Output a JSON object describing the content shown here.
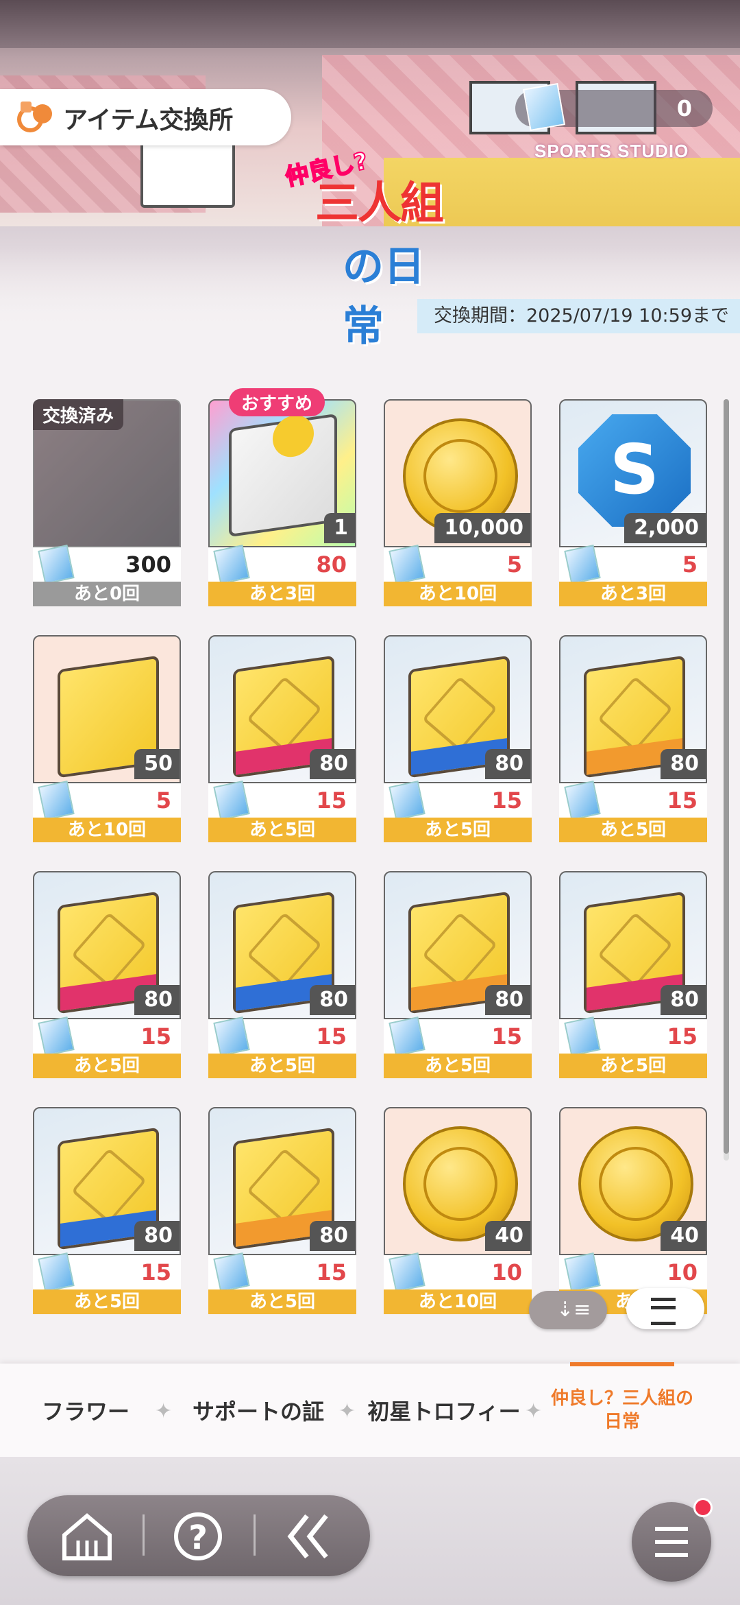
{
  "header": {
    "title": "アイテム交換所",
    "currency_value": "0",
    "event_logo_line1": "仲良し?",
    "event_logo_line2": "三人組",
    "event_logo_line3": "の日常",
    "studio_sign": "SPORTS STUDIO",
    "period": "交換期間：2025/07/19 10:59まで"
  },
  "items": [
    {
      "kind": "photo",
      "badge": "交換済み",
      "qty": "",
      "cost": "300",
      "remain": "あと0回",
      "state": "done"
    },
    {
      "kind": "gift",
      "badge": "おすすめ",
      "qty": "1",
      "cost": "80",
      "remain": "あと3回"
    },
    {
      "kind": "coin",
      "qty": "10,000",
      "cost": "5",
      "remain": "あと10回"
    },
    {
      "kind": "octa",
      "letter": "S",
      "qty": "2,000",
      "cost": "5",
      "remain": "あと3回"
    },
    {
      "kind": "book-plain",
      "qty": "50",
      "cost": "5",
      "remain": "あと10回"
    },
    {
      "kind": "book-pink",
      "qty": "80",
      "cost": "15",
      "remain": "あと5回"
    },
    {
      "kind": "book-blue",
      "qty": "80",
      "cost": "15",
      "remain": "あと5回"
    },
    {
      "kind": "book-orange",
      "qty": "80",
      "cost": "15",
      "remain": "あと5回"
    },
    {
      "kind": "book-pink",
      "qty": "80",
      "cost": "15",
      "remain": "あと5回"
    },
    {
      "kind": "book-blue",
      "qty": "80",
      "cost": "15",
      "remain": "あと5回"
    },
    {
      "kind": "book-orange",
      "qty": "80",
      "cost": "15",
      "remain": "あと5回"
    },
    {
      "kind": "book-pink",
      "qty": "80",
      "cost": "15",
      "remain": "あと5回"
    },
    {
      "kind": "book-blue",
      "qty": "80",
      "cost": "15",
      "remain": "あと5回"
    },
    {
      "kind": "book-orange",
      "qty": "80",
      "cost": "15",
      "remain": "あと5回"
    },
    {
      "kind": "coin",
      "qty": "40",
      "cost": "10",
      "remain": "あと10回"
    },
    {
      "kind": "coin",
      "qty": "40",
      "cost": "10",
      "remain": "あと"
    }
  ],
  "tabs": [
    {
      "label": "フラワー"
    },
    {
      "label": "サポートの証"
    },
    {
      "label": "初星トロフィー"
    },
    {
      "label": "仲良し？三人組の日常",
      "active": true
    }
  ],
  "colors": {
    "accent": "#ef7a2a",
    "remain_bar": "#f2b632",
    "cost_red": "#e2474b",
    "badge_pink": "#ef3d75"
  },
  "icons": {
    "home": "home-icon",
    "help": "help-icon",
    "back": "back-icon",
    "menu": "menu-icon",
    "sort": "sort-icon",
    "view": "list-view-icon"
  }
}
